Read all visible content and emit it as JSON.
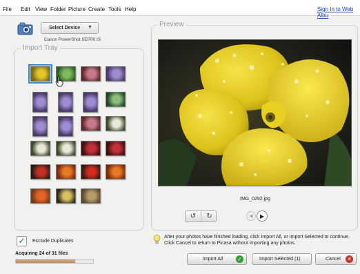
{
  "menu": [
    "File",
    "Edit",
    "View",
    "Folder",
    "Picture",
    "Create",
    "Tools",
    "Help"
  ],
  "signin_link": "Sign In to Web Albu",
  "device": {
    "select_label": "Select Device",
    "name": "Canon PowerShot SD700 IS"
  },
  "import_tray": {
    "title": "Import Tray",
    "thumbnails": [
      {
        "subject": "yellow flower",
        "selected": true
      },
      {
        "subject": "green leaves",
        "selected": false
      },
      {
        "subject": "pink flowers",
        "selected": false
      },
      {
        "subject": "purple flowers",
        "selected": false
      },
      {
        "subject": "purple flowers",
        "selected": false
      },
      {
        "subject": "purple flowers",
        "selected": false
      },
      {
        "subject": "purple flowers",
        "selected": false
      },
      {
        "subject": "green foliage",
        "selected": false
      },
      {
        "subject": "purple flowers",
        "selected": false
      },
      {
        "subject": "purple flowers",
        "selected": false
      },
      {
        "subject": "pink flowers",
        "selected": false
      },
      {
        "subject": "white flowers",
        "selected": false
      },
      {
        "subject": "white flowers",
        "selected": false
      },
      {
        "subject": "white flowers",
        "selected": false
      },
      {
        "subject": "red flowers",
        "selected": false
      },
      {
        "subject": "red flowers",
        "selected": false
      },
      {
        "subject": "red berries",
        "selected": false
      },
      {
        "subject": "orange flower",
        "selected": false
      },
      {
        "subject": "red flower",
        "selected": false
      },
      {
        "subject": "orange flower",
        "selected": false
      },
      {
        "subject": "orange fruit",
        "selected": false
      },
      {
        "subject": "yellow flowers",
        "selected": false
      },
      {
        "subject": "brown leaves",
        "selected": false
      }
    ]
  },
  "preview": {
    "title": "Preview",
    "filename": "IMG_0292.jpg"
  },
  "exclude_duplicates": {
    "label": "Exclude Duplicates",
    "checked": true
  },
  "status": {
    "text": "Acquiring 24 of 31 files",
    "progress": 0.77
  },
  "info_text": "After your photos have finished loading, click Import All, or Import Selected to continue. Click Cancel to return to Picasa without importing any photos.",
  "buttons": {
    "import_all": "Import All",
    "import_selected": "Import Selected (1)",
    "cancel": "Cancel"
  },
  "colors": {
    "link": "#1b3fae",
    "ok_green": "#3a9a38",
    "cancel_red": "#c8302a",
    "selection_blue": "#3b8ad9"
  }
}
